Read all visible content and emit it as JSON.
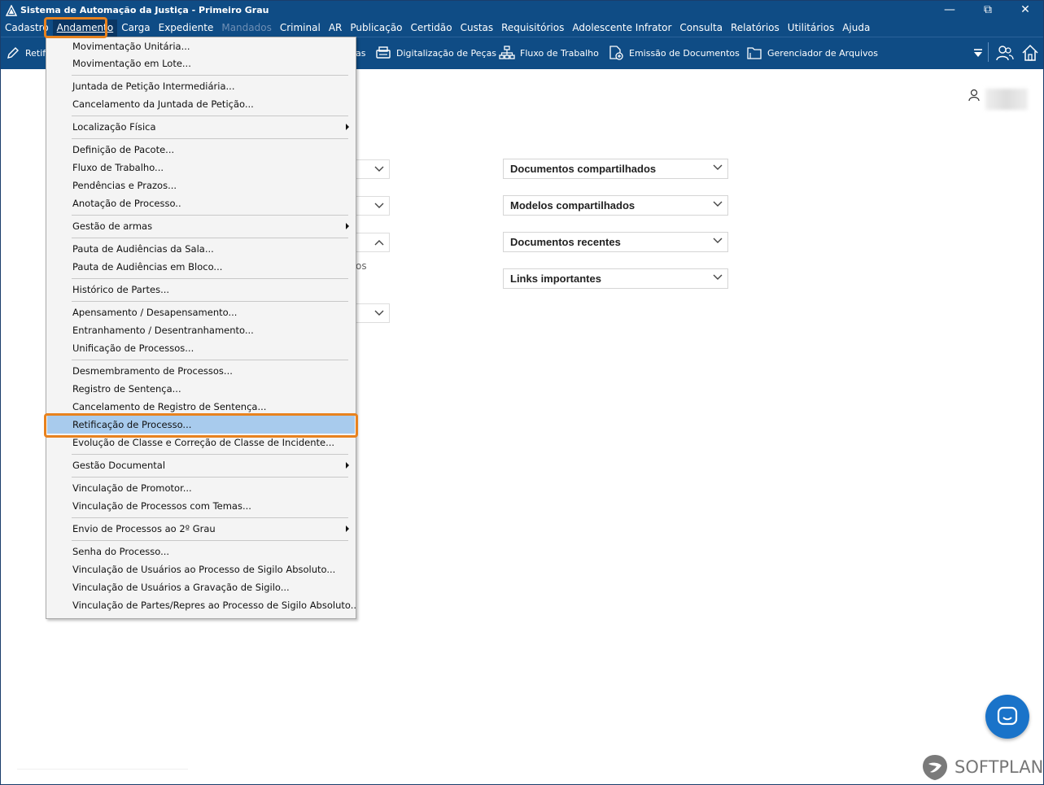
{
  "window": {
    "title": "Sistema de Automação da Justiça - Primeiro Grau",
    "controls": {
      "minimize": "—",
      "restore": "⧉",
      "close": "✕"
    }
  },
  "menubar": {
    "items": [
      {
        "label": "Cadastro",
        "state": "normal"
      },
      {
        "label": "Andamento",
        "state": "active"
      },
      {
        "label": "Carga",
        "state": "normal"
      },
      {
        "label": "Expediente",
        "state": "normal"
      },
      {
        "label": "Mandados",
        "state": "disabled"
      },
      {
        "label": "Criminal",
        "state": "normal"
      },
      {
        "label": "AR",
        "state": "normal"
      },
      {
        "label": "Publicação",
        "state": "normal"
      },
      {
        "label": "Certidão",
        "state": "normal"
      },
      {
        "label": "Custas",
        "state": "normal"
      },
      {
        "label": "Requisitórios",
        "state": "normal"
      },
      {
        "label": "Adolescente Infrator",
        "state": "normal"
      },
      {
        "label": "Consulta",
        "state": "normal"
      },
      {
        "label": "Relatórios",
        "state": "normal"
      },
      {
        "label": "Utilitários",
        "state": "normal"
      },
      {
        "label": "Ajuda",
        "state": "normal"
      }
    ]
  },
  "toolbar": {
    "retif_label": "Retif",
    "partial_label": "as",
    "digitalizacao_label": "Digitalização de Peças",
    "fluxo_label": "Fluxo de Trabalho",
    "emissao_label": "Emissão de Documentos",
    "gerenciador_label": "Gerenciador de Arquivos"
  },
  "main": {
    "partial_text": "os",
    "accordions": [
      {
        "label": "Documentos compartilhados"
      },
      {
        "label": "Modelos compartilhados"
      },
      {
        "label": "Documentos recentes"
      },
      {
        "label": "Links importantes"
      }
    ]
  },
  "andamento_menu": {
    "items": [
      {
        "label": "Movimentação Unitária...",
        "submenu": false
      },
      {
        "label": "Movimentação em Lote...",
        "submenu": false
      },
      {
        "label": "Juntada de Petição Intermediária...",
        "submenu": false
      },
      {
        "label": "Cancelamento da Juntada de Petição...",
        "submenu": false
      },
      {
        "label": "Localização Física",
        "submenu": true
      },
      {
        "label": "Definição de Pacote...",
        "submenu": false
      },
      {
        "label": "Fluxo de Trabalho...",
        "submenu": false
      },
      {
        "label": "Pendências e Prazos...",
        "submenu": false
      },
      {
        "label": "Anotação de Processo..",
        "submenu": false
      },
      {
        "label": "Gestão de armas",
        "submenu": true
      },
      {
        "label": "Pauta de Audiências da Sala...",
        "submenu": false
      },
      {
        "label": "Pauta de Audiências em Bloco...",
        "submenu": false
      },
      {
        "label": "Histórico de Partes...",
        "submenu": false
      },
      {
        "label": "Apensamento / Desapensamento...",
        "submenu": false
      },
      {
        "label": "Entranhamento / Desentranhamento...",
        "submenu": false
      },
      {
        "label": "Unificação de Processos...",
        "submenu": false
      },
      {
        "label": "Desmembramento de Processos...",
        "submenu": false
      },
      {
        "label": "Registro de Sentença...",
        "submenu": false
      },
      {
        "label": "Cancelamento de Registro de Sentença...",
        "submenu": false
      },
      {
        "label": "Retificação de Processo...",
        "submenu": false,
        "highlighted": true
      },
      {
        "label": "Evolução de Classe e Correção de Classe de Incidente...",
        "submenu": false
      },
      {
        "label": "Gestão Documental",
        "submenu": true
      },
      {
        "label": "Vinculação de Promotor...",
        "submenu": false
      },
      {
        "label": "Vinculação de Processos com Temas...",
        "submenu": false
      },
      {
        "label": "Envio de Processos ao 2º Grau",
        "submenu": true
      },
      {
        "label": "Senha do Processo...",
        "submenu": false
      },
      {
        "label": "Vinculação de Usuários ao Processo de Sigilo Absoluto...",
        "submenu": false
      },
      {
        "label": "Vinculação de Usuários a Gravação de Sigilo...",
        "submenu": false
      },
      {
        "label": "Vinculação de Partes/Repres ao Processo de Sigilo Absoluto..",
        "submenu": false
      }
    ]
  },
  "branding": {
    "watermark": "SOFTPLAN"
  },
  "colors": {
    "titlebar": "#0f4c85",
    "highlight": "#a8cbed",
    "callout": "#e8821e",
    "chat": "#1a73c9"
  },
  "icons": [
    "app-icon",
    "edit-icon",
    "scanner-icon",
    "workflow-icon",
    "document-emit-icon",
    "folder-icon",
    "filter-icon",
    "users-icon",
    "home-icon",
    "user-icon",
    "chevron-down-icon",
    "chevron-up-icon",
    "chat-icon",
    "softplan-logo-icon"
  ]
}
